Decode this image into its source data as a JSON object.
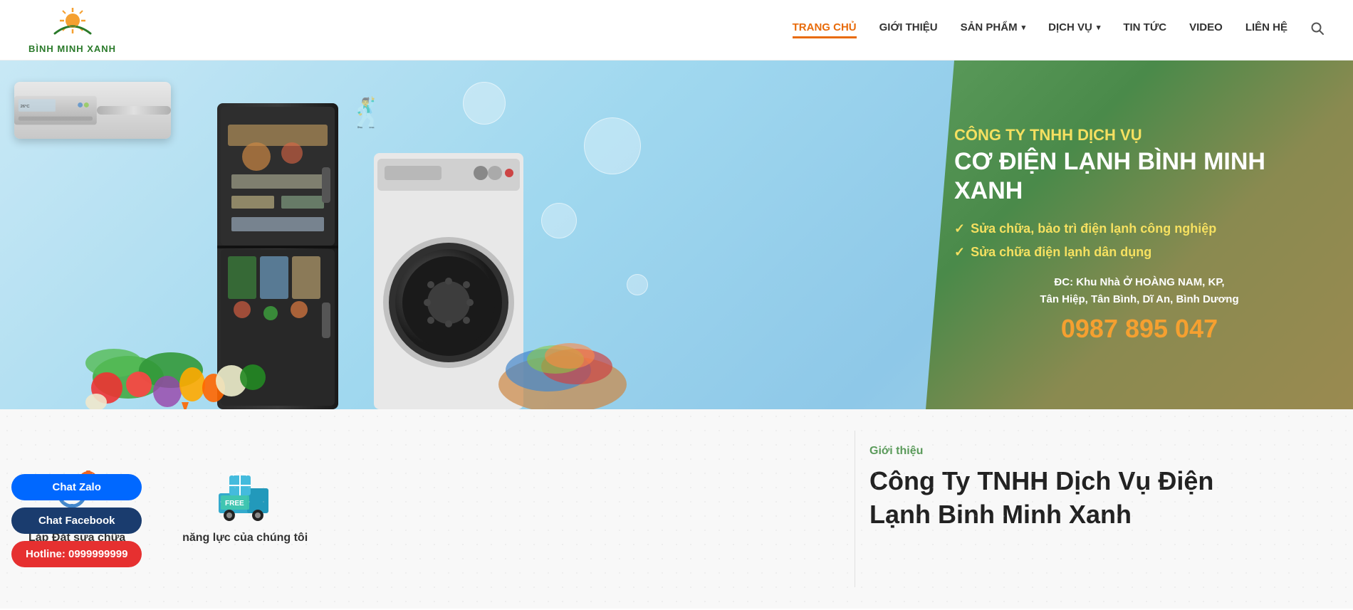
{
  "header": {
    "logo_text": "BÌNH MINH XANH",
    "nav_items": [
      {
        "label": "TRANG CHỦ",
        "active": true,
        "has_dropdown": false
      },
      {
        "label": "GIỚI THIỆU",
        "active": false,
        "has_dropdown": false
      },
      {
        "label": "SẢN PHẨM",
        "active": false,
        "has_dropdown": true
      },
      {
        "label": "DỊCH VỤ",
        "active": false,
        "has_dropdown": true
      },
      {
        "label": "TIN TỨC",
        "active": false,
        "has_dropdown": false
      },
      {
        "label": "VIDEO",
        "active": false,
        "has_dropdown": false
      },
      {
        "label": "LIÊN HỆ",
        "active": false,
        "has_dropdown": false
      }
    ]
  },
  "banner": {
    "subtitle": "CÔNG TY TNHH DỊCH VỤ",
    "title": "CƠ ĐIỆN LẠNH BÌNH MINH XANH",
    "features": [
      "Sửa chữa, bảo trì điện lạnh công nghiệp",
      "Sửa chữa điện lạnh dân dụng"
    ],
    "address_label": "ĐC: Khu Nhà Ở HOÀNG NAM, KP,",
    "address_detail": "Tân Hiệp, Tân Bình, Dĩ An, Bình Dương",
    "phone": "0987 895 047"
  },
  "chat_buttons": {
    "zalo_label": "Chat Zalo",
    "facebook_label": "Chat Facebook",
    "hotline_label": "Hotline: 0999999999"
  },
  "services": {
    "items": [
      {
        "icon": "gear",
        "label": "Lắp Đặt sửa chữa"
      },
      {
        "icon": "gift-truck",
        "label": "năng lực của chúng tôi"
      }
    ]
  },
  "intro": {
    "section_label": "Giới thiệu",
    "title_line1": "Công Ty TNHH Dịch Vụ Điện",
    "title_line2": "Lạnh Binh Minh Xanh"
  },
  "colors": {
    "primary_green": "#5a9a5a",
    "orange": "#e86b0a",
    "yellow": "#f5e060",
    "red": "#e63030",
    "facebook_blue": "#1a3c6e",
    "zalo_blue": "#0068ff"
  }
}
